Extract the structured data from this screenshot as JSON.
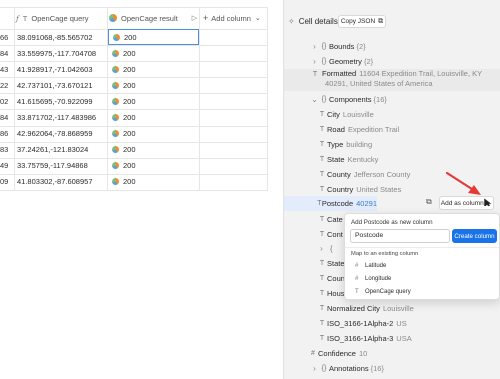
{
  "table": {
    "headers": {
      "first_partial": "",
      "query": "OpenCage query",
      "result": "OpenCage result",
      "add_column": "Add column"
    },
    "rows": [
      {
        "id": "66",
        "query": "38.091068,-85.565702",
        "result": "200"
      },
      {
        "id": "84",
        "query": "33.559975,-117.704708",
        "result": "200"
      },
      {
        "id": "43",
        "query": "41.928917,-71.042603",
        "result": "200"
      },
      {
        "id": "22",
        "query": "42.737101,-73.670121",
        "result": "200"
      },
      {
        "id": "02",
        "query": "41.615695,-70.922099",
        "result": "200"
      },
      {
        "id": "84",
        "query": "33.871702,-117.483986",
        "result": "200"
      },
      {
        "id": "86",
        "query": "42.962064,-78.868959",
        "result": "200"
      },
      {
        "id": "83",
        "query": "37.24261,-121.83024",
        "result": "200"
      },
      {
        "id": "49",
        "query": "33.75759,-117.94868",
        "result": "200"
      },
      {
        "id": "09",
        "query": "41.803302,-87.608957",
        "result": "200"
      }
    ]
  },
  "panel": {
    "title": "Cell details",
    "copy_json": "Copy JSON",
    "tree": {
      "bounds": {
        "key": "Bounds",
        "count": "{2}"
      },
      "geometry": {
        "key": "Geometry",
        "count": "{2}"
      },
      "formatted": {
        "key": "Formatted",
        "value_line1": "11604 Expedition Trail, Louisville, KY",
        "value_line2": "40291, United States of America"
      },
      "components": {
        "key": "Components",
        "count": "{16}"
      },
      "city": {
        "key": "City",
        "value": "Louisville"
      },
      "road": {
        "key": "Road",
        "value": "Expedition Trail"
      },
      "type": {
        "key": "Type",
        "value": "building"
      },
      "state": {
        "key": "State",
        "value": "Kentucky"
      },
      "county": {
        "key": "County",
        "value": "Jefferson County"
      },
      "country": {
        "key": "Country",
        "value": "United States"
      },
      "postcode": {
        "key": "Postcode",
        "value": "40291"
      },
      "cate": {
        "key": "Cate"
      },
      "cont": {
        "key": "Cont"
      },
      "hidden_obj": {
        "key": "{"
      },
      "state2": {
        "key": "State"
      },
      "coun": {
        "key": "Coun"
      },
      "hous": {
        "key": "Hous"
      },
      "normalized_city": {
        "key": "Normalized City",
        "value": "Louisville"
      },
      "iso2": {
        "key": "ISO_3166-1Alpha-2",
        "value": "US"
      },
      "iso3": {
        "key": "ISO_3166-1Alpha-3",
        "value": "USA"
      },
      "confidence": {
        "key": "Confidence",
        "value": "10"
      },
      "annotations": {
        "key": "Annotations",
        "count": "{16}"
      }
    },
    "add_as_column": "Add as column"
  },
  "popup": {
    "title": "Add Postcode as new column",
    "input_value": "Postcode",
    "create_button": "Create column",
    "map_label": "Map to an existing column",
    "options": [
      "Latitude",
      "Longitude",
      "OpenCage query"
    ]
  },
  "colors": {
    "accent": "#1a73e8",
    "arrow": "#e53935",
    "selected_border": "#4a8fe0",
    "link_value": "#3d7bd6"
  }
}
